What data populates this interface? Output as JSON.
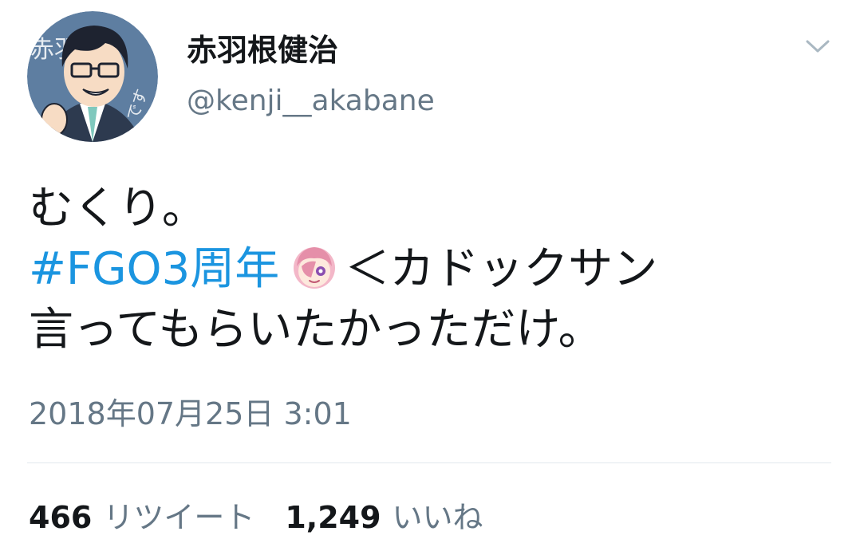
{
  "author": {
    "display_name": "赤羽根健治",
    "handle": "@kenji__akabane",
    "avatar_text": "赤羽根",
    "avatar_badge": "です"
  },
  "header": {
    "menu_icon": "chevron-down-icon"
  },
  "tweet": {
    "line1": "むくり。",
    "hashtag": "#FGO3周年",
    "emoji_icon": "anime-girl-face-emoji",
    "line2_rest": "＜カドックサン",
    "line3": "言ってもらいたかっただけ。",
    "timestamp": "2018年07月25日 3:01"
  },
  "stats": {
    "retweets_count": "466",
    "retweets_label": "リツイート",
    "likes_count": "1,249",
    "likes_label": "いいね"
  },
  "colors": {
    "text": "#14171a",
    "muted": "#657786",
    "link": "#1b95e0",
    "divider": "#e1e8ed"
  }
}
